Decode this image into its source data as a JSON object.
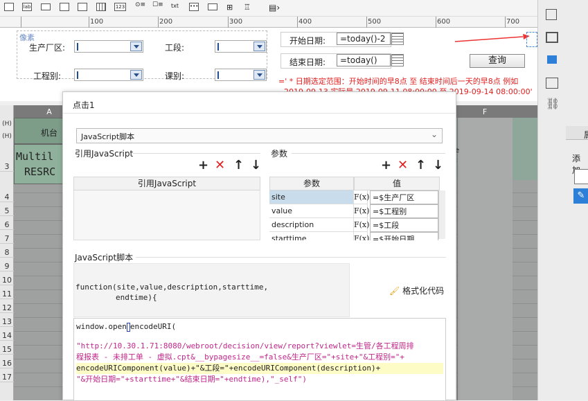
{
  "toolbar": {
    "icons": [
      "textbox-icon",
      "label-icon",
      "button-icon",
      "combobox-icon",
      "datepicker-icon",
      "grid-icon",
      "number-icon",
      "radio-group-icon",
      "checkbox-group-icon",
      "text-icon",
      "password-icon",
      "tree-icon",
      "arrow-icon"
    ],
    "label_text": "lab",
    "number_text": "123",
    "txt_text": "txt"
  },
  "ruler": {
    "labels": [
      "100",
      "200",
      "300",
      "400",
      "500",
      "600",
      "700"
    ]
  },
  "form": {
    "pixel_label": "像素",
    "plant_area": {
      "label": "生产厂区:"
    },
    "section": {
      "label": "工段:"
    },
    "eng_type": {
      "label": "工程别:"
    },
    "dept": {
      "label": "课别:"
    },
    "start_date": {
      "label": "开始日期:",
      "value": "=today()-2"
    },
    "end_date": {
      "label": "结束日期:",
      "value": "=today()"
    },
    "query_button": "查询",
    "note_line1": "=' * 日期选定范围：开始时间的早8点 至 结束时间后一天的早8点 例如",
    "note_line2": "2019-09-13 实际是 2019-09-11 08:00:00 至 2019-09-14 08:00:00'"
  },
  "sheet": {
    "col_a": "A",
    "col_f": "F",
    "machine_header": "机台",
    "cell_text_1": "Multil",
    "cell_text_2": "RESRC",
    "row_h1": "(H)",
    "row_h2": "(H)",
    "rows": [
      "3",
      "4",
      "5",
      "6",
      "7",
      "8",
      "9",
      "10",
      "11",
      "12",
      "13",
      "14",
      "15",
      "16",
      "17"
    ],
    "right_text_1": "e",
    "right_text_2": ":"
  },
  "right_panel": {
    "tab_label": "属",
    "add_label": "添加"
  },
  "dialog": {
    "title": "点击1",
    "type_select": "JavaScript脚本",
    "ref_js_section": "引用JavaScript",
    "ref_js_header": "引用JavaScript",
    "params_section": "参数",
    "params_col_param": "参数",
    "params_col_value": "值",
    "params": [
      {
        "name": "site",
        "value": "=$生产厂区"
      },
      {
        "name": "value",
        "value": "=$工程别"
      },
      {
        "name": "description",
        "value": "=$工段"
      },
      {
        "name": "starttime",
        "value": "=$开始日期"
      }
    ],
    "fx_label": "F(x)",
    "js_section": "JavaScript脚本",
    "function_sig_1": "function(site,value,description,starttime,",
    "function_sig_2": "endtime){",
    "format_code": "格式化代码",
    "code_line1_pre": "window.open",
    "code_line1_post": "encodeURI(",
    "code_line2": "\"http://10.30.1.71:8080/webroot/decision/view/report?viewlet=生管/各工程周排",
    "code_line3": "程报表 - 未排工单 - 虚拟.cpt&__bypagesize__=false&生产厂区=\"+site+\"&工程别=\"+",
    "code_line4": "encodeURIComponent(value)+\"&工段=\"+encodeURIComponent(description)+",
    "code_line5": "\"&开始日期=\"+starttime+\"&结束日期=\"+endtime),\"_self\")"
  }
}
